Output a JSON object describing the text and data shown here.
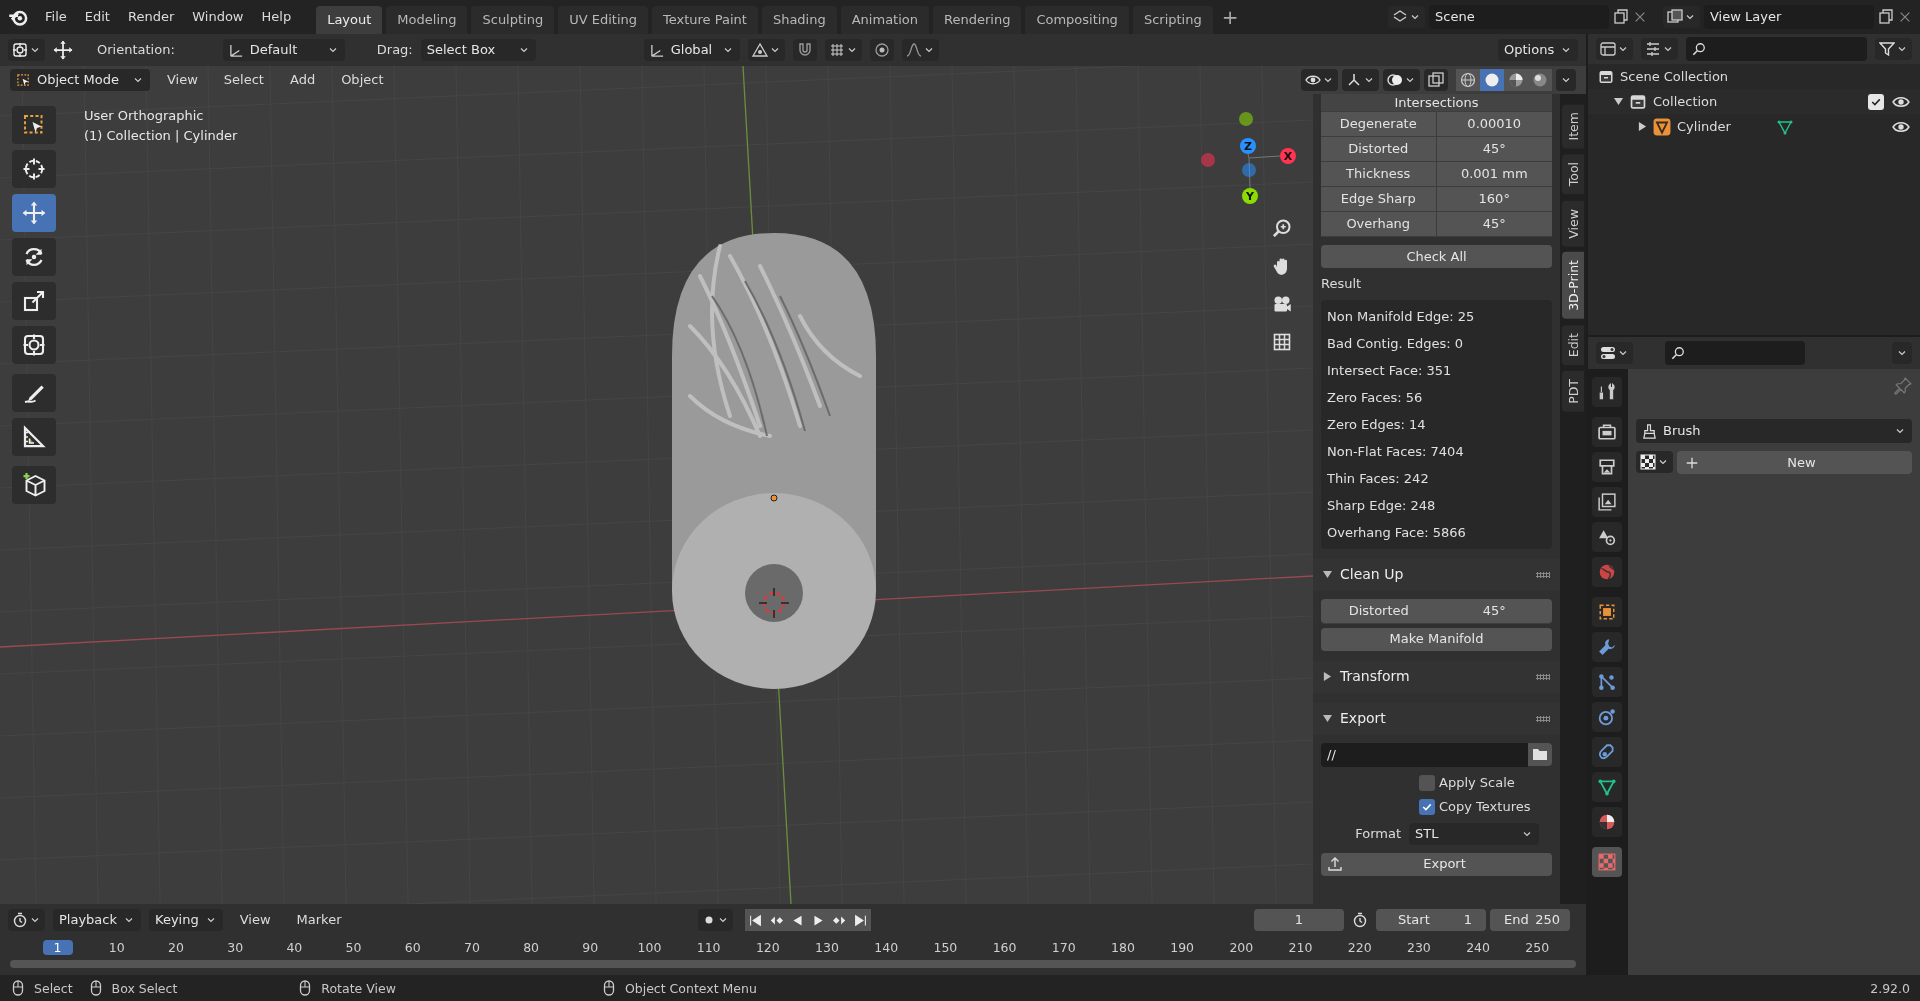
{
  "menu_bar": {
    "menus": [
      "File",
      "Edit",
      "Render",
      "Window",
      "Help"
    ],
    "workspaces": [
      {
        "label": "Layout",
        "selected": true
      },
      {
        "label": "Modeling",
        "selected": false
      },
      {
        "label": "Sculpting",
        "selected": false
      },
      {
        "label": "UV Editing",
        "selected": false
      },
      {
        "label": "Texture Paint",
        "selected": false
      },
      {
        "label": "Shading",
        "selected": false
      },
      {
        "label": "Animation",
        "selected": false
      },
      {
        "label": "Rendering",
        "selected": false
      },
      {
        "label": "Compositing",
        "selected": false
      },
      {
        "label": "Scripting",
        "selected": false
      }
    ],
    "add_workspace": "+",
    "scene": "Scene",
    "view_layer": "View Layer"
  },
  "tool_header": {
    "orientation_label": "Orientation:",
    "orientation": "Default",
    "drag_label": "Drag:",
    "drag": "Select Box",
    "transform_orientation": "Global",
    "options": "Options"
  },
  "viewport_header": {
    "mode": "Object Mode",
    "menus": [
      "View",
      "Select",
      "Add",
      "Object"
    ],
    "shading": [
      {
        "kind": "wireframe",
        "selected": false
      },
      {
        "kind": "solid",
        "selected": true
      },
      {
        "kind": "material",
        "selected": false
      },
      {
        "kind": "rendered",
        "selected": false
      }
    ]
  },
  "viewport": {
    "view_name": "User Orthographic",
    "object_info": "(1) Collection | Cylinder",
    "gizmo": [
      {
        "label": "X",
        "color": "#ff3352"
      },
      {
        "label": "Y",
        "color": "#8bdc00"
      },
      {
        "label": "Z",
        "color": "#2890ff"
      }
    ]
  },
  "toolbar": [
    {
      "kind": "select",
      "selected": false
    },
    {
      "kind": "cursor",
      "selected": false
    },
    {
      "kind": "move",
      "selected": true
    },
    {
      "kind": "rotate",
      "selected": false
    },
    {
      "kind": "scale",
      "selected": false
    },
    {
      "kind": "transform",
      "selected": false
    },
    {
      "kind": "annotate",
      "selected": false
    },
    {
      "kind": "measure",
      "selected": false
    },
    {
      "kind": "add-cube",
      "selected": false
    }
  ],
  "sidebar": {
    "tabs": [
      {
        "label": "Item",
        "selected": false
      },
      {
        "label": "Tool",
        "selected": false
      },
      {
        "label": "View",
        "selected": false
      },
      {
        "label": "3D-Print",
        "selected": true
      },
      {
        "label": "Edit",
        "selected": false
      },
      {
        "label": "PDT",
        "selected": false
      }
    ],
    "intersections_title": "Intersections",
    "checks": [
      {
        "label": "Degenerate",
        "value": "0.00010"
      },
      {
        "label": "Distorted",
        "value": "45°"
      },
      {
        "label": "Thickness",
        "value": "0.001 mm"
      },
      {
        "label": "Edge Sharp",
        "value": "160°"
      },
      {
        "label": "Overhang",
        "value": "45°"
      }
    ],
    "check_all": "Check All",
    "result_label": "Result",
    "results": [
      "Non Manifold Edge: 25",
      "Bad Contig. Edges: 0",
      "Intersect Face: 351",
      "Zero Faces: 56",
      "Zero Edges: 14",
      "Non-Flat Faces: 7404",
      "Thin Faces: 242",
      "Sharp Edge: 248",
      "Overhang Face: 5866"
    ],
    "cleanup": {
      "title": "Clean Up",
      "expanded": true,
      "distorted_label": "Distorted",
      "distorted_value": "45°",
      "button": "Make Manifold"
    },
    "transform": {
      "title": "Transform",
      "expanded": false
    },
    "export": {
      "title": "Export",
      "expanded": true,
      "path": "//",
      "options": [
        {
          "label": "Apply Scale",
          "checked": false
        },
        {
          "label": "Copy Textures",
          "checked": true
        }
      ],
      "format_label": "Format",
      "format": "STL",
      "button": "Export"
    }
  },
  "outliner": {
    "root": "Scene Collection",
    "items": [
      {
        "name": "Collection",
        "expanded": true,
        "checked": true,
        "visible": true,
        "children": [
          {
            "name": "Cylinder",
            "expanded": false,
            "visible": true
          }
        ]
      }
    ]
  },
  "properties": {
    "tabs": [
      {
        "kind": "tool",
        "selected": false
      },
      {
        "kind": "render",
        "selected": false
      },
      {
        "kind": "output",
        "selected": false
      },
      {
        "kind": "view-layer",
        "selected": false
      },
      {
        "kind": "scene",
        "selected": false
      },
      {
        "kind": "world",
        "selected": false
      },
      {
        "kind": "object",
        "selected": false
      },
      {
        "kind": "modifiers",
        "selected": false
      },
      {
        "kind": "particles",
        "selected": false
      },
      {
        "kind": "physics",
        "selected": false
      },
      {
        "kind": "constraints",
        "selected": false
      },
      {
        "kind": "data",
        "selected": false
      },
      {
        "kind": "material",
        "selected": false
      },
      {
        "kind": "texture",
        "selected": true
      }
    ],
    "brush": "Brush",
    "new_button": "New"
  },
  "timeline": {
    "menus": [
      "Playback",
      "Keying",
      "View",
      "Marker"
    ],
    "current_frame": "1",
    "start_label": "Start",
    "start": "1",
    "end_label": "End",
    "end": "250",
    "frames": [
      {
        "label": "1",
        "current": true
      },
      {
        "label": "10",
        "current": false
      },
      {
        "label": "20",
        "current": false
      },
      {
        "label": "30",
        "current": false
      },
      {
        "label": "40",
        "current": false
      },
      {
        "label": "50",
        "current": false
      },
      {
        "label": "60",
        "current": false
      },
      {
        "label": "70",
        "current": false
      },
      {
        "label": "80",
        "current": false
      },
      {
        "label": "90",
        "current": false
      },
      {
        "label": "100",
        "current": false
      },
      {
        "label": "110",
        "current": false
      },
      {
        "label": "120",
        "current": false
      },
      {
        "label": "130",
        "current": false
      },
      {
        "label": "140",
        "current": false
      },
      {
        "label": "150",
        "current": false
      },
      {
        "label": "160",
        "current": false
      },
      {
        "label": "170",
        "current": false
      },
      {
        "label": "180",
        "current": false
      },
      {
        "label": "190",
        "current": false
      },
      {
        "label": "200",
        "current": false
      },
      {
        "label": "210",
        "current": false
      },
      {
        "label": "220",
        "current": false
      },
      {
        "label": "230",
        "current": false
      },
      {
        "label": "240",
        "current": false
      },
      {
        "label": "250",
        "current": false
      }
    ]
  },
  "status_bar": {
    "hints": [
      "Select",
      "Box Select",
      "Rotate View",
      "Object Context Menu"
    ],
    "version": "2.92.0"
  }
}
